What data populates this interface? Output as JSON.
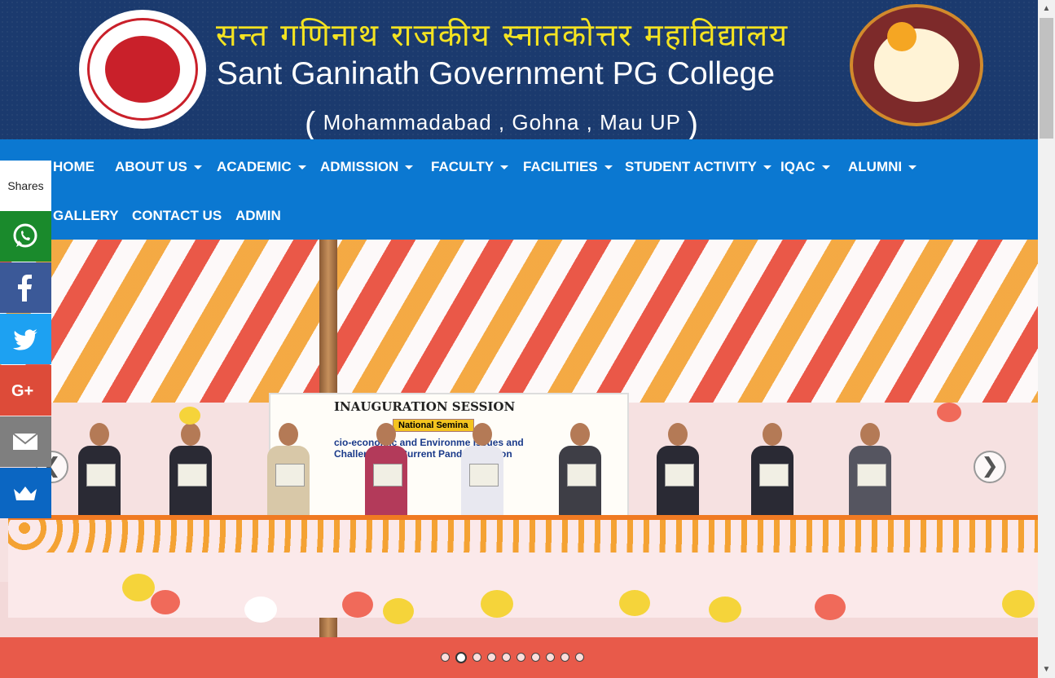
{
  "header": {
    "title_hindi": "सन्त गणिनाथ राजकीय स्नातकोत्तर महाविद्यालय",
    "title_english": "Sant Ganinath Government PG College",
    "location": "Mohammadabad , Gohna , Mau UP",
    "paren_open": "(",
    "paren_close": ")"
  },
  "nav": {
    "items": [
      {
        "label": "HOME"
      },
      {
        "label": "ABOUT US"
      },
      {
        "label": "ACADEMIC"
      },
      {
        "label": "ADMISSION"
      },
      {
        "label": "FACULTY"
      },
      {
        "label": "FACILITIES"
      },
      {
        "label": "STUDENT ACTIVITY"
      },
      {
        "label": "IQAC"
      },
      {
        "label": "ALUMNI"
      },
      {
        "label": "GALLERY"
      },
      {
        "label": "CONTACT US"
      },
      {
        "label": "ADMIN"
      }
    ]
  },
  "slider": {
    "board_title": "INAUGURATION SESSION",
    "board_subtitle": "National Semina",
    "board_line1": "cio-economic and Environme    Issues and",
    "board_line2": "Challenges in Current Pande     Situation",
    "next_symbol": "❯",
    "prev_symbol": "❮",
    "slide_count": 10,
    "active_slide": 2
  },
  "share": {
    "label": "Shares",
    "buttons": [
      {
        "name": "whatsapp",
        "color": "#1a8a2c"
      },
      {
        "name": "facebook",
        "color": "#3b5998"
      },
      {
        "name": "twitter",
        "color": "#1da1f2"
      },
      {
        "name": "google-plus",
        "color": "#dd4b39"
      },
      {
        "name": "email",
        "color": "#7f7f7f"
      },
      {
        "name": "sumome",
        "color": "#0b66c2"
      }
    ]
  },
  "colors": {
    "banner_bg": "#1b3a6e",
    "title_hindi": "#f4e321",
    "nav_bg": "#0b78d1"
  }
}
